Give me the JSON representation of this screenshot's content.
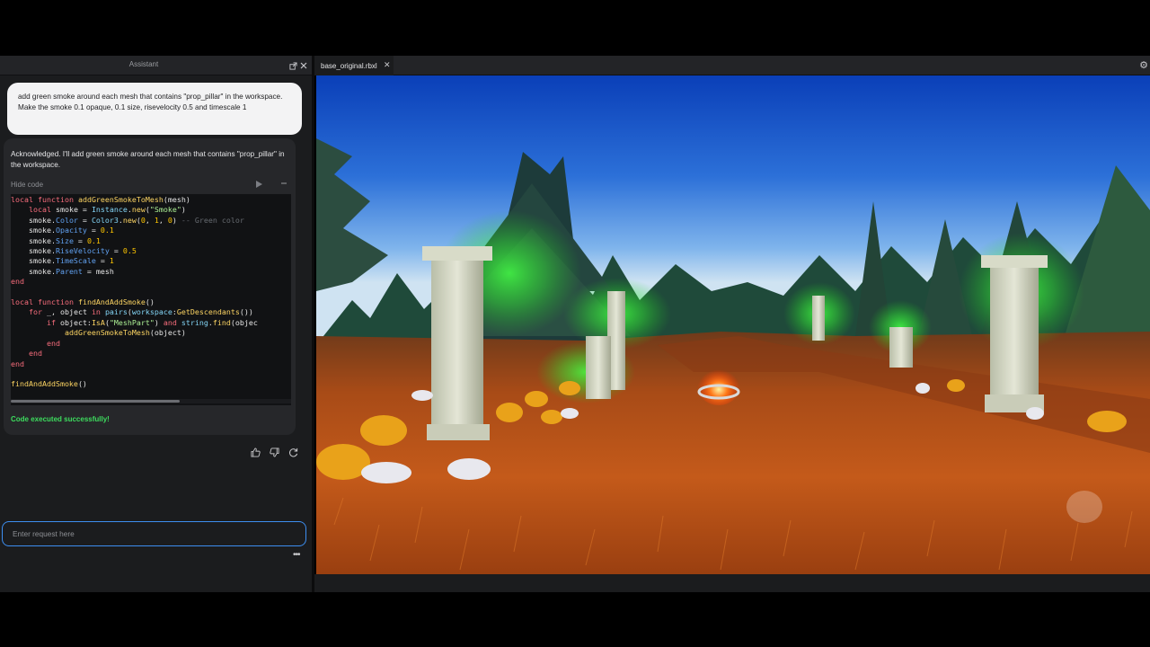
{
  "assistant": {
    "title": "Assistant",
    "user_message": "add green smoke around each mesh that contains \"prop_pillar\" in the workspace. Make the smoke 0.1 opaque, 0.1 size, risevelocity 0.5 and timescale 1",
    "reply": "Acknowledged. I'll add green smoke around each mesh that contains \"prop_pillar\" in the workspace.",
    "hide_code_label": "Hide code",
    "status": "Code executed successfully!",
    "input_placeholder": "Enter request here",
    "code_lines": [
      "local function addGreenSmokeToMesh(mesh)",
      "    local smoke = Instance.new(\"Smoke\")",
      "    smoke.Color = Color3.new(0, 1, 0) -- Green color",
      "    smoke.Opacity = 0.1",
      "    smoke.Size = 0.1",
      "    smoke.RiseVelocity = 0.5",
      "    smoke.TimeScale = 1",
      "    smoke.Parent = mesh",
      "end",
      "",
      "local function findAndAddSmoke()",
      "    for _, object in pairs(workspace:GetDescendants())",
      "        if object:IsA(\"MeshPart\") and string.find(objec",
      "            addGreenSmokeToMesh(object)",
      "        end",
      "    end",
      "end",
      "",
      "findAndAddSmoke()"
    ],
    "icons": {
      "popout": "popout-icon",
      "close": "close-icon",
      "run": "play-icon",
      "collapse": "collapse-icon",
      "thumbs_up": "thumbs-up-icon",
      "thumbs_down": "thumbs-down-icon",
      "regenerate": "refresh-icon",
      "more": "more-icon"
    }
  },
  "viewport": {
    "tab_label": "base_original.rbxl",
    "scene": "Halloween graveyard with stone pillars, pumpkins, pine trees and green smoke"
  },
  "colors": {
    "panel_bg": "#1b1c1e",
    "code_bg": "#111214",
    "input_border": "#3d8ef0",
    "success": "#3ddc5e",
    "smoke": "#33ff44"
  }
}
